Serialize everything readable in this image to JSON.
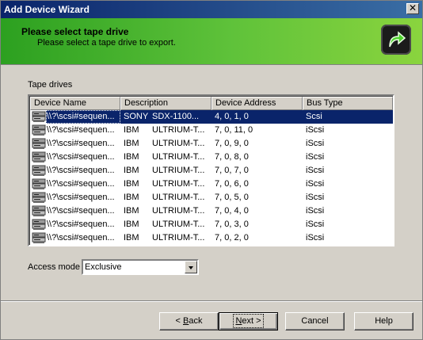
{
  "window": {
    "title": "Add Device Wizard",
    "close_glyph": "✕"
  },
  "header": {
    "title": "Please select tape drive",
    "subtitle": "Please select a tape drive to export.",
    "icon": "green-forward-arrow-icon"
  },
  "tape_drives": {
    "label": "Tape drives",
    "columns": [
      "Device Name",
      "Description",
      "Device Address",
      "Bus Type"
    ],
    "rows": [
      {
        "name": "\\\\?\\scsi#sequen...",
        "vendor": "SONY",
        "model": "SDX-1100...",
        "address": "4, 0, 1, 0",
        "bus": "Scsi",
        "selected": true
      },
      {
        "name": "\\\\?\\scsi#sequen...",
        "vendor": "IBM",
        "model": "ULTRIUM-T...",
        "address": "7, 0, 11, 0",
        "bus": "iScsi"
      },
      {
        "name": "\\\\?\\scsi#sequen...",
        "vendor": "IBM",
        "model": "ULTRIUM-T...",
        "address": "7, 0, 9, 0",
        "bus": "iScsi"
      },
      {
        "name": "\\\\?\\scsi#sequen...",
        "vendor": "IBM",
        "model": "ULTRIUM-T...",
        "address": "7, 0, 8, 0",
        "bus": "iScsi"
      },
      {
        "name": "\\\\?\\scsi#sequen...",
        "vendor": "IBM",
        "model": "ULTRIUM-T...",
        "address": "7, 0, 7, 0",
        "bus": "iScsi"
      },
      {
        "name": "\\\\?\\scsi#sequen...",
        "vendor": "IBM",
        "model": "ULTRIUM-T...",
        "address": "7, 0, 6, 0",
        "bus": "iScsi"
      },
      {
        "name": "\\\\?\\scsi#sequen...",
        "vendor": "IBM",
        "model": "ULTRIUM-T...",
        "address": "7, 0, 5, 0",
        "bus": "iScsi"
      },
      {
        "name": "\\\\?\\scsi#sequen...",
        "vendor": "IBM",
        "model": "ULTRIUM-T...",
        "address": "7, 0, 4, 0",
        "bus": "iScsi"
      },
      {
        "name": "\\\\?\\scsi#sequen...",
        "vendor": "IBM",
        "model": "ULTRIUM-T...",
        "address": "7, 0, 3, 0",
        "bus": "iScsi"
      },
      {
        "name": "\\\\?\\scsi#sequen...",
        "vendor": "IBM",
        "model": "ULTRIUM-T...",
        "address": "7, 0, 2, 0",
        "bus": "iScsi"
      }
    ]
  },
  "access_mode": {
    "label": "Access mode",
    "value": "Exclusive"
  },
  "buttons": {
    "back": {
      "pre": "< ",
      "accel": "B",
      "post": "ack"
    },
    "next": {
      "accel": "N",
      "post": "ext >"
    },
    "cancel": "Cancel",
    "help": "Help"
  },
  "colors": {
    "selection": "#0a246a",
    "header_green": "#5fc23a",
    "titlebar": "#0a246a"
  }
}
